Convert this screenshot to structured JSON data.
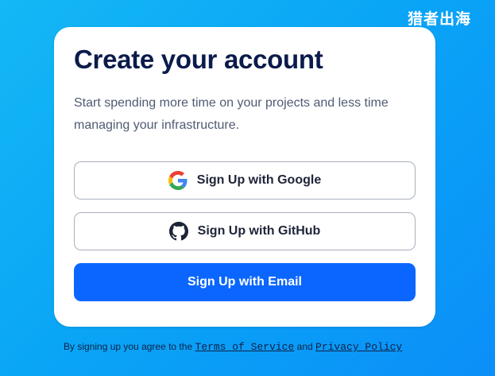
{
  "watermark": "猎者出海",
  "card": {
    "title": "Create your account",
    "description": "Start spending more time on your projects and less time managing your infrastructure."
  },
  "buttons": {
    "google": {
      "label": "Sign Up with Google",
      "icon": "google-icon"
    },
    "github": {
      "label": "Sign Up with GitHub",
      "icon": "github-icon"
    },
    "email": {
      "label": "Sign Up with Email"
    }
  },
  "footer": {
    "prefix": "By signing up you agree to the",
    "terms_link": "Terms of Service",
    "conjunction": "and",
    "privacy_link": "Privacy Policy"
  },
  "colors": {
    "background": "#0aa6f6",
    "title": "#0b1b4b",
    "primary_button": "#0a66ff"
  }
}
